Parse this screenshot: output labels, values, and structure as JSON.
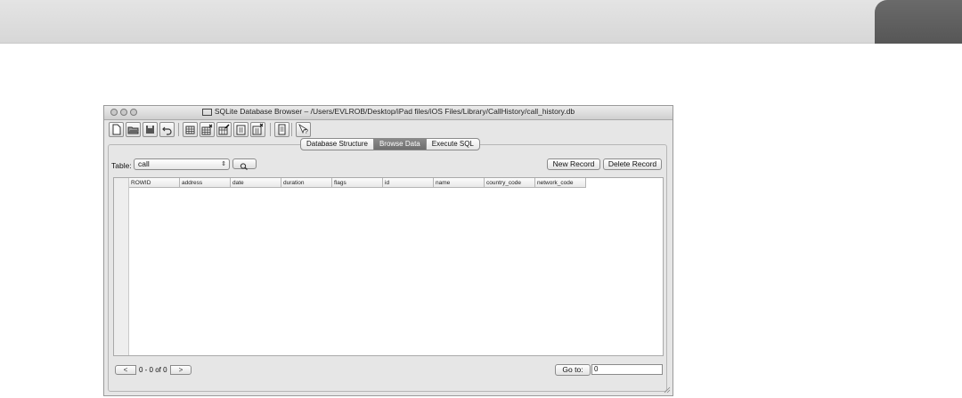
{
  "window": {
    "title": "SQLite Database Browser – /Users/EVLROB/Desktop/iPad files/iOS Files/Library/CallHistory/call_history.db"
  },
  "toolbar": {
    "items": [
      {
        "name": "new-database-icon"
      },
      {
        "name": "open-database-icon"
      },
      {
        "name": "save-icon"
      },
      {
        "name": "undo-icon"
      },
      {
        "name": "create-table-icon"
      },
      {
        "name": "delete-table-icon"
      },
      {
        "name": "modify-table-icon"
      },
      {
        "name": "create-index-icon"
      },
      {
        "name": "delete-index-icon"
      },
      {
        "name": "preferences-icon"
      },
      {
        "name": "whats-this-icon",
        "glyph": "?"
      }
    ]
  },
  "tabs": [
    {
      "label": "Database Structure",
      "active": false
    },
    {
      "label": "Browse Data",
      "active": true
    },
    {
      "label": "Execute SQL",
      "active": false
    }
  ],
  "browse": {
    "table_label": "Table:",
    "table_value": "call",
    "new_record": "New Record",
    "delete_record": "Delete Record"
  },
  "grid": {
    "columns": [
      "ROWID",
      "address",
      "date",
      "duration",
      "flags",
      "id",
      "name",
      "country_code",
      "network_code"
    ]
  },
  "pager": {
    "prev": "<",
    "next": ">",
    "status": "0 - 0 of 0",
    "goto_label": "Go to:",
    "goto_value": "0"
  }
}
